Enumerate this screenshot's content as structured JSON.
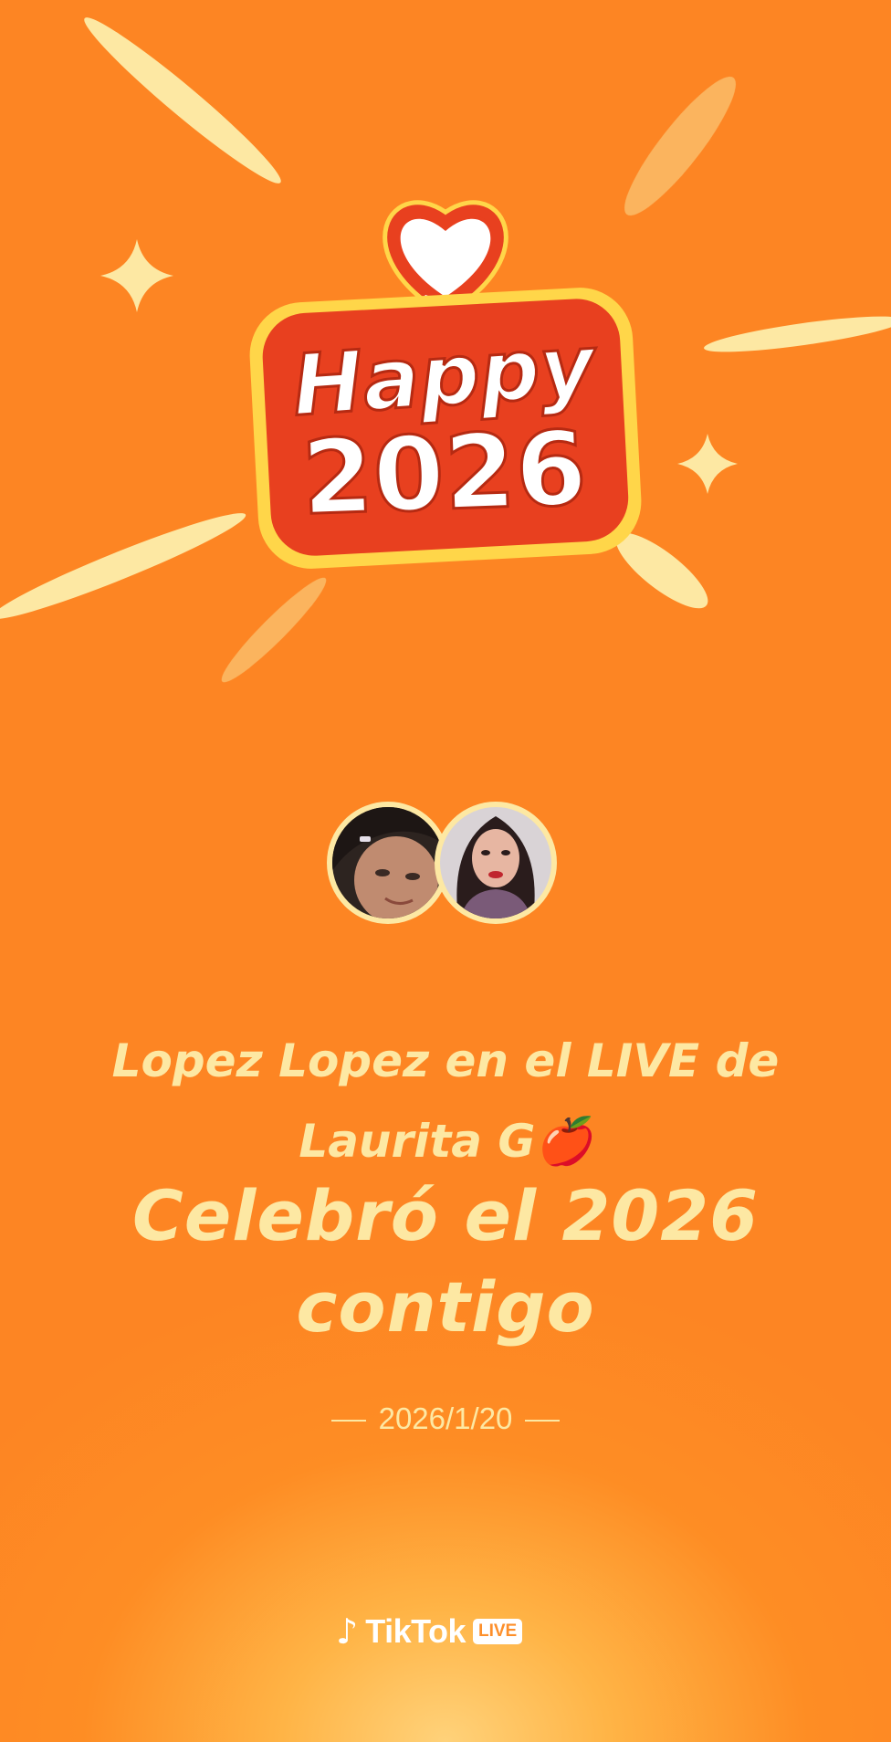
{
  "logo": {
    "line1": "Happy",
    "line2": "2026"
  },
  "participants": [
    {
      "name": "Lopez Lopez"
    },
    {
      "name": "Laurita G"
    }
  ],
  "message": {
    "line1": "Lopez Lopez en el LIVE de",
    "line2": "Laurita G🍎",
    "headline_line1": "Celebró el 2026",
    "headline_line2": "contigo"
  },
  "date": "2026/1/20",
  "brand": {
    "name": "TikTok",
    "badge": "LIVE"
  },
  "colors": {
    "background": "#fd8523",
    "accent_text": "#fde8a3",
    "logo_red": "#e8401f",
    "logo_yellow": "#ffd649"
  },
  "icons": [
    "heart-speech-bubble-icon",
    "sparkle-icon",
    "tiktok-logo-icon",
    "apple-emoji-icon"
  ]
}
